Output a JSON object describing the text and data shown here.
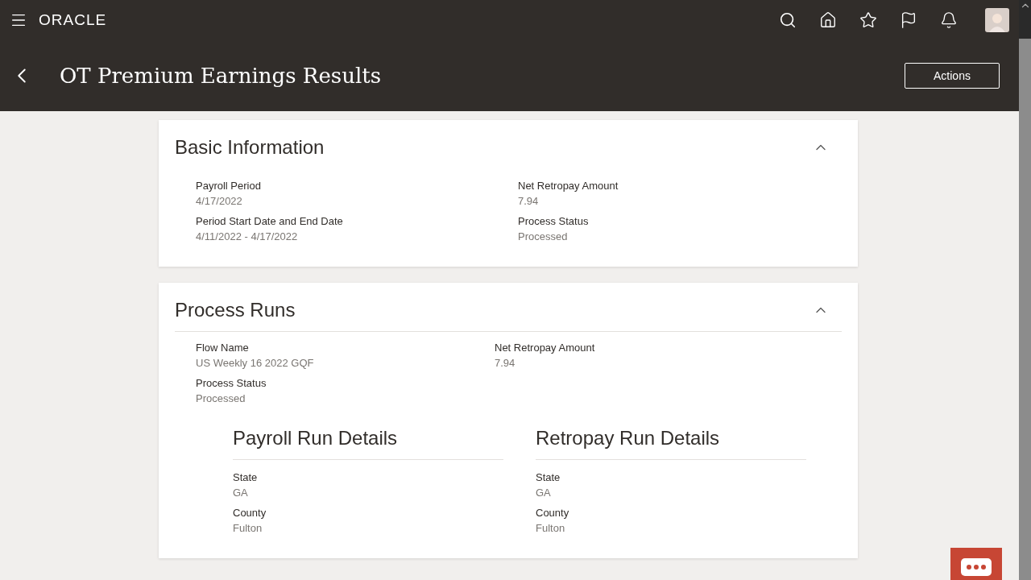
{
  "header": {
    "logo": "ORACLE"
  },
  "page": {
    "title": "OT Premium Earnings Results",
    "actions_button": "Actions"
  },
  "basic_information": {
    "title": "Basic Information",
    "expanded": true,
    "fields": [
      {
        "label": "Payroll Period",
        "value": "4/17/2022"
      },
      {
        "label": "Net Retropay Amount",
        "value": "7.94"
      },
      {
        "label": "Period Start Date and End Date",
        "value": "4/11/2022 - 4/17/2022"
      },
      {
        "label": "Process Status",
        "value": "Processed"
      }
    ]
  },
  "process_runs": {
    "title": "Process Runs",
    "expanded": true,
    "fields": [
      {
        "label": "Flow Name",
        "value": "US Weekly 16 2022 GQF"
      },
      {
        "label": "Net Retropay Amount",
        "value": "7.94"
      },
      {
        "label": "Process Status",
        "value": "Processed"
      }
    ],
    "details": [
      {
        "title": "Payroll Run Details",
        "fields": [
          {
            "label": "State",
            "value": "GA"
          },
          {
            "label": "County",
            "value": "Fulton"
          }
        ]
      },
      {
        "title": "Retropay Run Details",
        "fields": [
          {
            "label": "State",
            "value": "GA"
          },
          {
            "label": "County",
            "value": "Fulton"
          }
        ]
      }
    ]
  }
}
